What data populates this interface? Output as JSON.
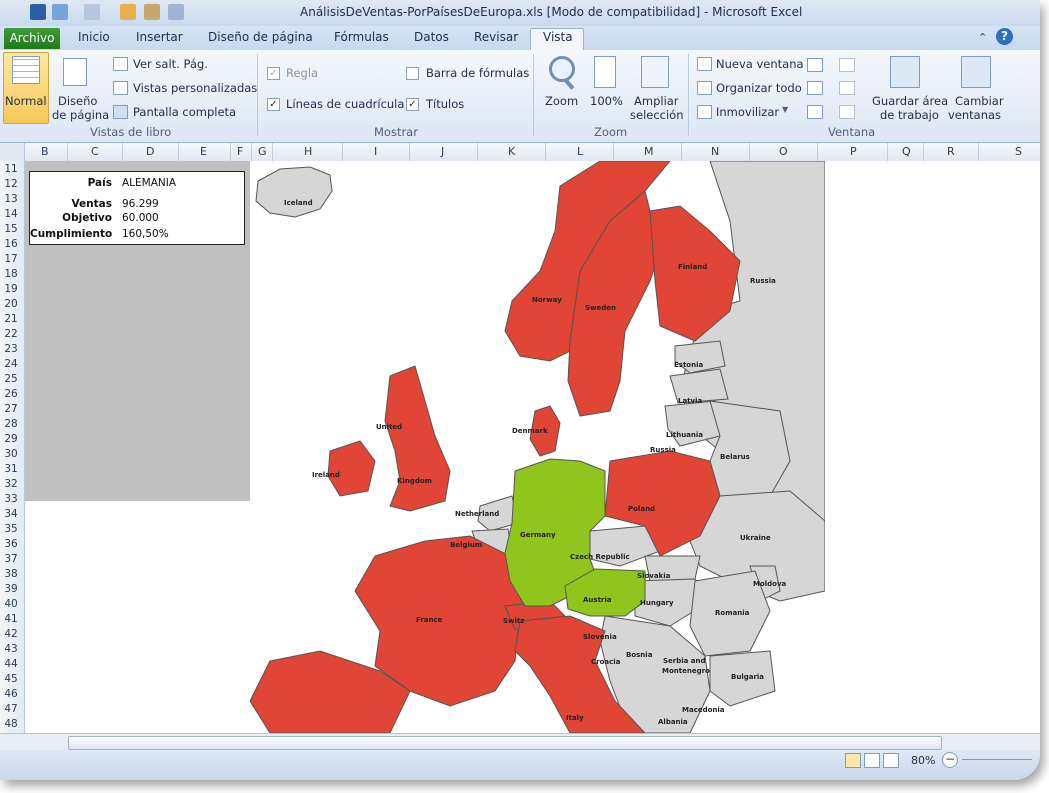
{
  "window": {
    "title": "AnálisisDeVentas-PorPaísesDeEuropa.xls  [Modo de compatibilidad]  -  Microsoft Excel"
  },
  "tabs": [
    "Archivo",
    "Inicio",
    "Insertar",
    "Diseño de página",
    "Fórmulas",
    "Datos",
    "Revisar",
    "Vista"
  ],
  "ribbon": {
    "vistas_libro": {
      "normal": "Normal",
      "diseno_1": "Diseño",
      "diseno_2": "de página",
      "ver_salt": "Ver salt. Pág.",
      "vistas_pers": "Vistas personalizadas",
      "pantalla": "Pantalla completa",
      "group": "Vistas de libro"
    },
    "mostrar": {
      "regla": "Regla",
      "lineas": "Líneas de cuadrícula",
      "barra": "Barra de fórmulas",
      "titulos": "Títulos",
      "group": "Mostrar"
    },
    "zoom": {
      "zoom": "Zoom",
      "cien": "100%",
      "ampliar_1": "Ampliar",
      "ampliar_2": "selección",
      "group": "Zoom"
    },
    "ventana": {
      "nueva": "Nueva ventana",
      "organizar": "Organizar todo",
      "inmovilizar": "Inmovilizar",
      "guardar_1": "Guardar área",
      "guardar_2": "de trabajo",
      "cambiar_1": "Cambiar",
      "cambiar_2": "ventanas",
      "group": "Ventana"
    }
  },
  "columns": [
    "B",
    "C",
    "D",
    "E",
    "F",
    "G",
    "H",
    "I",
    "J",
    "K",
    "L",
    "M",
    "N",
    "O",
    "P",
    "Q",
    "R",
    "S"
  ],
  "rows": [
    "11",
    "12",
    "13",
    "14",
    "15",
    "16",
    "17",
    "18",
    "19",
    "20",
    "21",
    "22",
    "23",
    "24",
    "25",
    "26",
    "27",
    "28",
    "29",
    "30",
    "31",
    "32",
    "33",
    "34",
    "35",
    "36",
    "37",
    "38",
    "39",
    "40",
    "41",
    "42",
    "43",
    "44",
    "45",
    "46",
    "47",
    "48"
  ],
  "info": {
    "pais_label": "País",
    "pais_value": "ALEMANIA",
    "ventas_label": "Ventas",
    "ventas_value": "96.299",
    "objetivo_label": "Objetivo",
    "objetivo_value": "60.000",
    "cumpl_label": "Cumplimiento",
    "cumpl_value": "160,50%"
  },
  "countries": {
    "iceland": "Iceland",
    "norway": "Norway",
    "sweden": "Sweden",
    "finland": "Finland",
    "russia": "Russia",
    "estonia": "Estonia",
    "latvia": "Latvia",
    "lithuania": "Lithuania",
    "russia2": "Russia",
    "belarus": "Belarus",
    "denmark": "Denmark",
    "united": "United",
    "kingdom": "Kingdom",
    "ireland": "Ireland",
    "netherland": "Netherland",
    "belgium": "Belgium",
    "germany": "Germany",
    "poland": "Poland",
    "ukraine": "Ukraine",
    "czech": "Czech Republic",
    "slovakia": "Slovakia",
    "austria": "Austria",
    "hungary": "Hungary",
    "moldova": "Moldova",
    "romania": "Romania",
    "france": "France",
    "switz": "Switz",
    "slovenia": "Slovenia",
    "croacia": "Croacia",
    "bosnia": "Bosnia",
    "serbia": "Serbia and",
    "montenegro": "Montenegro",
    "bulgaria": "Bulgaria",
    "macedonia": "Macedonia",
    "albania": "Albania",
    "italy": "Italy"
  },
  "colors": {
    "red": "#e04535",
    "green": "#8fc51c",
    "grey": "#d6d6d6"
  },
  "status": {
    "zoom": "80%"
  }
}
